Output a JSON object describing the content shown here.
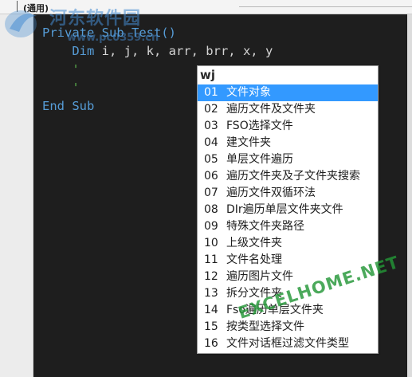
{
  "topbar": {
    "scope_label": "(通用)"
  },
  "code_lines": [
    {
      "parts": [
        {
          "t": "Private Sub Test()",
          "c": "kw"
        }
      ]
    },
    {
      "parts": [
        {
          "t": "    "
        },
        {
          "t": "Dim",
          "c": "kw"
        },
        {
          "t": " i, j, k, arr, brr, x, y"
        }
      ]
    },
    {
      "parts": [
        {
          "t": "    "
        },
        {
          "t": "'",
          "c": "cm"
        }
      ]
    },
    {
      "parts": [
        {
          "t": "    "
        },
        {
          "t": "'",
          "c": "cm"
        }
      ]
    },
    {
      "parts": [
        {
          "t": "End Sub",
          "c": "kw"
        }
      ]
    }
  ],
  "popup": {
    "search": "wj",
    "selected_index": 0,
    "items": [
      {
        "num": "01",
        "label": "文件对象"
      },
      {
        "num": "02",
        "label": "遍历文件及文件夹"
      },
      {
        "num": "03",
        "label": "FSO选择文件"
      },
      {
        "num": "04",
        "label": "建文件夹"
      },
      {
        "num": "05",
        "label": "单层文件遍历"
      },
      {
        "num": "06",
        "label": "遍历文件夹及子文件夹搜索"
      },
      {
        "num": "07",
        "label": "遍历文件双循环法"
      },
      {
        "num": "08",
        "label": "DIr遍历单层文件夹文件"
      },
      {
        "num": "09",
        "label": "特殊文件夹路径"
      },
      {
        "num": "10",
        "label": "上级文件夹"
      },
      {
        "num": "11",
        "label": "文件名处理"
      },
      {
        "num": "12",
        "label": "遍历图片文件"
      },
      {
        "num": "13",
        "label": "拆分文件夹"
      },
      {
        "num": "14",
        "label": "Fso遍历单层文件夹"
      },
      {
        "num": "15",
        "label": "按类型选择文件"
      },
      {
        "num": "16",
        "label": "文件对话框过滤文件类型"
      }
    ]
  },
  "watermarks": {
    "site_name": "河东软件园",
    "site_url": "www.pc0359.cn",
    "excelhome": "EXCELHOME.NET"
  },
  "colors": {
    "editor_bg": "#1e1e1e",
    "keyword": "#569cd6",
    "comment": "#57a64a",
    "selection": "#3399ff"
  }
}
